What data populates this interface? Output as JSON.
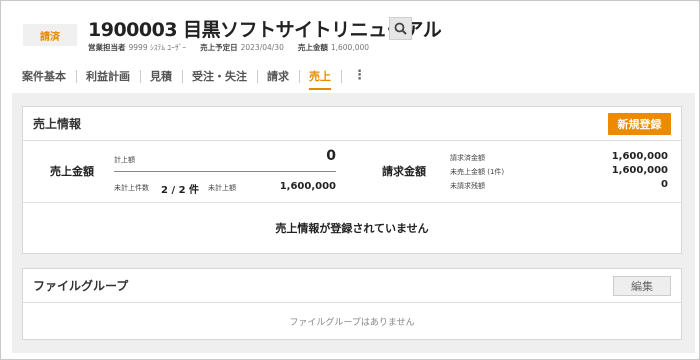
{
  "header": {
    "status_badge": "請済",
    "title": "1900003 目黒ソフトサイトリニューアル",
    "meta": [
      {
        "label": "営業担当者",
        "value": "9999 ｼｽﾃﾑ ﾕｰｻﾞｰ"
      },
      {
        "label": "売上予定日",
        "value": "2023/04/30"
      },
      {
        "label": "売上金額",
        "value": "1,600,000"
      }
    ]
  },
  "tabs": [
    {
      "label": "案件基本"
    },
    {
      "label": "利益計画"
    },
    {
      "label": "見積"
    },
    {
      "label": "受注・失注"
    },
    {
      "label": "請求"
    },
    {
      "label": "売上",
      "active": true
    }
  ],
  "kebab": "⋮",
  "sales": {
    "title": "売上情報",
    "register_button": "新規登録",
    "sales_amount_label": "売上金額",
    "recorded_label": "計上額",
    "recorded_value": "0",
    "unrecorded_count_label": "未計上件数",
    "unrecorded_count_value": "2 / 2 件",
    "unrecorded_amount_label": "未計上額",
    "unrecorded_amount_value": "1,600,000",
    "billing_amount_label": "請求金額",
    "billed_label": "請求済金額",
    "billed_value": "1,600,000",
    "unsold_label": "未売上金額 (1件)",
    "unsold_value": "1,600,000",
    "unbilled_label": "未請求残額",
    "unbilled_value": "0",
    "empty_message": "売上情報が登録されていません"
  },
  "files": {
    "title": "ファイルグループ",
    "edit_button": "編集",
    "empty_message": "ファイルグループはありません"
  },
  "colors": {
    "accent": "#ee8a00",
    "badge_text": "#e68a00"
  }
}
